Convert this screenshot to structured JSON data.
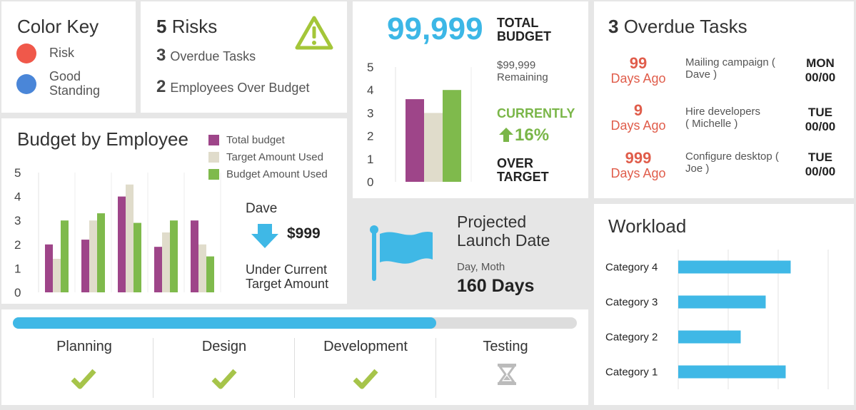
{
  "color_key": {
    "title": "Color Key",
    "items": [
      {
        "label": "Risk",
        "color": "#f0584a"
      },
      {
        "label_line1": "Good",
        "label_line2": "Standing",
        "color": "#4a86d8"
      }
    ]
  },
  "risks": {
    "risks_count": "5",
    "risks_label": "Risks",
    "overdue_count": "3",
    "overdue_label": "Overdue Tasks",
    "over_budget_count": "2",
    "over_budget_label": "Employees Over Budget",
    "icon": "warning-triangle-icon",
    "icon_color": "#a4c639"
  },
  "budget": {
    "total_value": "99,999",
    "total_label_1": "TOTAL",
    "total_label_2": "BUDGET",
    "remaining_1": "$99,999",
    "remaining_2": "Remaining",
    "currently": "CURRENTLY",
    "percent": "16%",
    "over_1": "OVER",
    "over_2": "TARGET"
  },
  "employee": {
    "title": "Budget by Employee",
    "name": "Dave",
    "amount": "$999",
    "note_1": "Under Current",
    "note_2": "Target Amount"
  },
  "launch": {
    "title_1": "Projected",
    "title_2": "Launch Date",
    "sub": "Day, Moth",
    "days": "160 Days"
  },
  "overdue": {
    "count": "3",
    "title": "Overdue Tasks",
    "tasks": [
      {
        "num": "99",
        "ago": "Days Ago",
        "task_1": "Mailing campaign (",
        "task_2": "Dave )",
        "day": "MON",
        "date": "00/00"
      },
      {
        "num": "9",
        "ago": "Days Ago",
        "task_1": "Hire developers",
        "task_2": "( Michelle )",
        "day": "TUE",
        "date": "00/00"
      },
      {
        "num": "999",
        "ago": "Days Ago",
        "task_1": "Configure desktop (",
        "task_2": "Joe )",
        "day": "TUE",
        "date": "00/00"
      }
    ]
  },
  "progress": {
    "fraction": 0.75,
    "stages": [
      {
        "label": "Planning",
        "status": "check-icon"
      },
      {
        "label": "Design",
        "status": "check-icon"
      },
      {
        "label": "Development",
        "status": "check-icon"
      },
      {
        "label": "Testing",
        "status": "hourglass-icon"
      }
    ],
    "bar_color": "#3fb8e6",
    "track_color": "#dddddd"
  },
  "chart_data": [
    {
      "id": "budget_by_employee",
      "type": "bar",
      "title": "Budget by Employee",
      "categories": [
        "",
        "",
        "",
        "",
        ""
      ],
      "series": [
        {
          "name": "Total budget",
          "color": "#9e4589",
          "values": [
            2.0,
            2.2,
            4.0,
            1.9,
            3.0
          ]
        },
        {
          "name": "Target Amount Used",
          "color": "#e0dccb",
          "values": [
            1.4,
            3.0,
            4.5,
            2.5,
            2.0
          ]
        },
        {
          "name": "Budget Amount Used",
          "color": "#7fba4c",
          "values": [
            3.0,
            3.3,
            2.9,
            3.0,
            1.5
          ]
        }
      ],
      "yticks": [
        "0",
        "1",
        "2",
        "3",
        "4",
        "5"
      ],
      "ylim": [
        0,
        5
      ],
      "legend": "top-right"
    },
    {
      "id": "total_budget",
      "type": "bar",
      "categories": [
        ""
      ],
      "series": [
        {
          "name": "Total budget",
          "color": "#9e4589",
          "values": [
            3.6
          ]
        },
        {
          "name": "Target Amount Used",
          "color": "#e0dccb",
          "values": [
            3.0
          ]
        },
        {
          "name": "Budget Amount Used",
          "color": "#7fba4c",
          "values": [
            4.0
          ]
        }
      ],
      "yticks": [
        "0",
        "1",
        "2",
        "3",
        "4",
        "5"
      ],
      "ylim": [
        0,
        5
      ]
    },
    {
      "id": "workload",
      "type": "bar",
      "orientation": "horizontal",
      "title": "Workload",
      "categories": [
        "Category 4",
        "Category 3",
        "Category 2",
        "Category 1"
      ],
      "values": [
        4.5,
        3.5,
        2.5,
        4.3
      ],
      "xlim": [
        0,
        6
      ],
      "color": "#3fb8e6"
    }
  ]
}
